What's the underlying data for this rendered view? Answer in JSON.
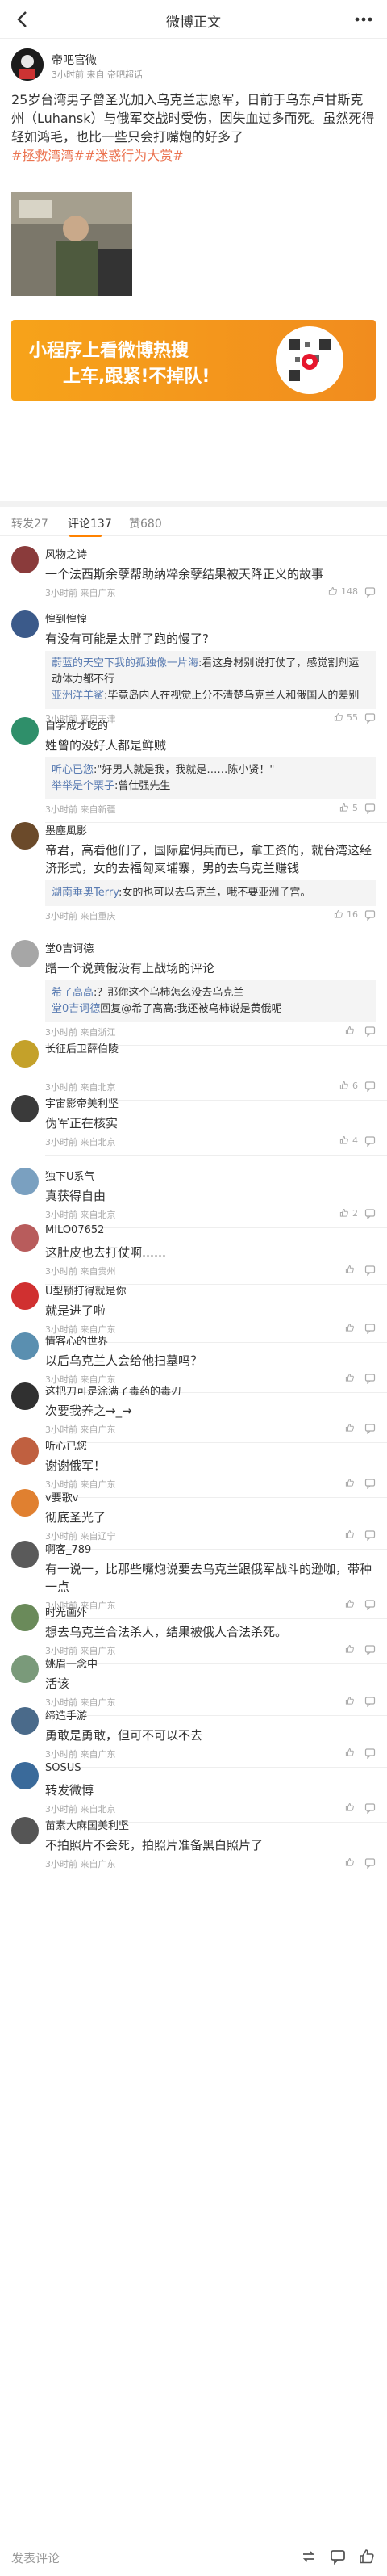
{
  "header": {
    "title": "微博正文"
  },
  "post": {
    "author": "帝吧官微",
    "meta": "3小时前 来自 帝吧超话",
    "text": "25岁台湾男子曾圣光加入乌克兰志愿军，日前于乌东卢甘斯克州（Luhansk）与俄军交战时受伤，因失血过多而死。虽然死得轻如鸿毛，也比一些只会打嘴炮的好多了",
    "topics": "#拯救湾湾##迷惑行为大赏#"
  },
  "banner": {
    "line1": "小程序上看微博热搜",
    "line2": "上车,跟紧!不掉队!"
  },
  "tabs": {
    "repost": "转发27",
    "comment": "评论137",
    "like": "赞680"
  },
  "comments": [
    {
      "name": "风物之诗",
      "text": "一个法西斯余孽帮助纳粹余孽结果被天降正义的故事",
      "meta": "3小时前 来自广东",
      "likes": "148"
    },
    {
      "name": "惶到惶惶",
      "text": "有没有可能是太胖了跑的慢了?",
      "meta": "3小时前 来自天津",
      "likes": "55",
      "replies": [
        {
          "n": "蔚蓝的天空下我的孤独像一片海",
          "t": ":看这身材别说打仗了，感觉割剂运动体力都不行"
        },
        {
          "n": "亚洲洋羊鲨",
          "t": ":毕竟岛内人在视觉上分不清楚乌克兰人和俄国人的差别"
        }
      ]
    },
    {
      "name": "自学成才吃的",
      "text": "姓曾的没好人都是鲜贼",
      "meta": "3小时前 来自新疆",
      "likes": "5",
      "replies": [
        {
          "n": "听心已您",
          "t": ":\"好男人就是我，我就是……陈小贤！\""
        },
        {
          "n": "举举是个栗子",
          "t": ":曾仕强先生"
        }
      ]
    },
    {
      "name": "墨塵風影",
      "text": "帝君，高看他们了，国际雇佣兵而已，拿工资的，就台湾这经济形式，女的去福匈柬埔寨，男的去乌克兰赚钱",
      "meta": "3小时前 来自重庆",
      "likes": "16",
      "replies": [
        {
          "n": "湖南垂奥Terry",
          "t": ":女的也可以去乌克兰，哦不要亚洲子宫。"
        }
      ]
    },
    {
      "name": "堂0吉诃德",
      "text": "蹭一个说黄俄没有上战场的评论",
      "meta": "3小时前 来自浙江",
      "likes": "",
      "replies": [
        {
          "n": "希了高高",
          "t": ":？那你这个乌柿怎么没去乌克兰"
        },
        {
          "n": "堂0吉诃德",
          "t": "回复@希了高高:我还被乌柿说是黄俄呢"
        }
      ]
    },
    {
      "name": "长征后卫薛伯陵",
      "text": "",
      "meta": "3小时前 来自北京",
      "likes": "6"
    },
    {
      "name": "宇宙影帝美利坚",
      "text": "伪军正在核实",
      "meta": "3小时前 来自北京",
      "likes": "4"
    },
    {
      "name": "独下U系气",
      "text": "真获得自由",
      "meta": "3小时前 来自北京",
      "likes": "2"
    },
    {
      "name": "MILO07652",
      "text": "这肚皮也去打仗啊……",
      "meta": "3小时前 来自贵州",
      "likes": ""
    },
    {
      "name": "U型锁打得就是你",
      "text": "就是进了啦",
      "meta": "3小时前 来自广东",
      "likes": ""
    },
    {
      "name": "情客心的世界",
      "text": "以后乌克兰人会给他扫墓吗？",
      "meta": "3小时前 来自广东",
      "likes": ""
    },
    {
      "name": "这把刀可是涂满了毒药的毒刃",
      "text": "次要我养之→_→",
      "meta": "3小时前 来自广东",
      "likes": ""
    },
    {
      "name": "听心已您",
      "text": "谢谢俄军！",
      "meta": "3小时前 来自广东",
      "likes": ""
    },
    {
      "name": "v要歌v",
      "text": "彻底圣光了",
      "meta": "3小时前 来自辽宁",
      "likes": ""
    },
    {
      "name": "啊客_789",
      "text": "有一说一，比那些嘴炮说要去乌克兰跟俄军战斗的逊咖，带种一点",
      "meta": "3小时前 来自广东",
      "likes": ""
    },
    {
      "name": "时光画外",
      "text": "想去乌克兰合法杀人，结果被俄人合法杀死。",
      "meta": "3小时前 来自广东",
      "likes": ""
    },
    {
      "name": "姚眉一念中",
      "text": "活该",
      "meta": "3小时前 来自广东",
      "likes": ""
    },
    {
      "name": "缔造手游",
      "text": "勇敢是勇敢，但可不可以不去",
      "meta": "3小时前 来自广东",
      "likes": ""
    },
    {
      "name": "SOSUS",
      "text": "转发微博",
      "meta": "3小时前 来自北京",
      "likes": ""
    },
    {
      "name": "苗素大麻国美利坚",
      "text": "不拍照片不会死，拍照片准备黑白照片了",
      "meta": "3小时前 来自广东",
      "likes": ""
    }
  ],
  "bottom": {
    "placeholder": "发表评论"
  },
  "colors": {
    "accent": "#ff8200",
    "link": "#5a7cb2",
    "topic": "#eb7350"
  }
}
